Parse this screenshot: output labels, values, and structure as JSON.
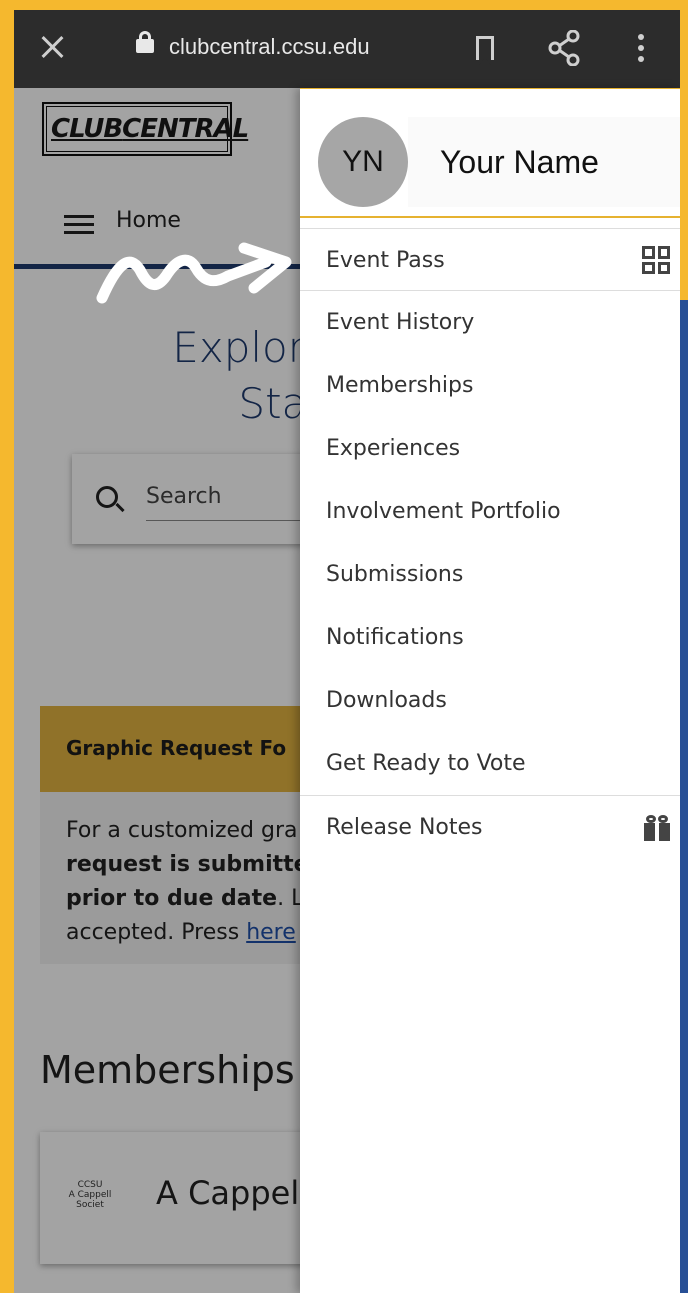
{
  "browser": {
    "url": "clubcentral.ccsu.edu"
  },
  "page": {
    "logo_text_1": "CLUB",
    "logo_text_2": "CENTRAL",
    "nav_home": "Home",
    "hero_line1": "Explore Cer",
    "hero_line2": "State",
    "search_placeholder": "Search",
    "banner_title": "Graphic Request Fo",
    "banner_text_1": "For a customized gra",
    "banner_bold_1": "request is submitte",
    "banner_bold_2": "prior to due date",
    "banner_text_2": ". L",
    "banner_text_3": "accepted. Press ",
    "banner_link": "here",
    "memberships_title": "Memberships",
    "member_logo_1": "CCSU",
    "member_logo_2": "A Cappell",
    "member_logo_3": "Societ",
    "member_name": "A Cappell"
  },
  "drawer": {
    "avatar_initials": "YN",
    "user_name": "Your Name",
    "items": [
      {
        "label": "Event Pass",
        "icon": "qr-code-icon"
      },
      {
        "label": "Event History"
      },
      {
        "label": "Memberships"
      },
      {
        "label": "Experiences"
      },
      {
        "label": "Involvement Portfolio"
      },
      {
        "label": "Submissions"
      },
      {
        "label": "Notifications"
      },
      {
        "label": "Downloads"
      },
      {
        "label": "Get Ready to Vote"
      },
      {
        "label": "Release Notes",
        "icon": "gift-icon"
      }
    ]
  },
  "colors": {
    "brand_blue": "#1f3a6e",
    "accent_gold": "#e6b230",
    "background_gold": "#f5b82e"
  }
}
